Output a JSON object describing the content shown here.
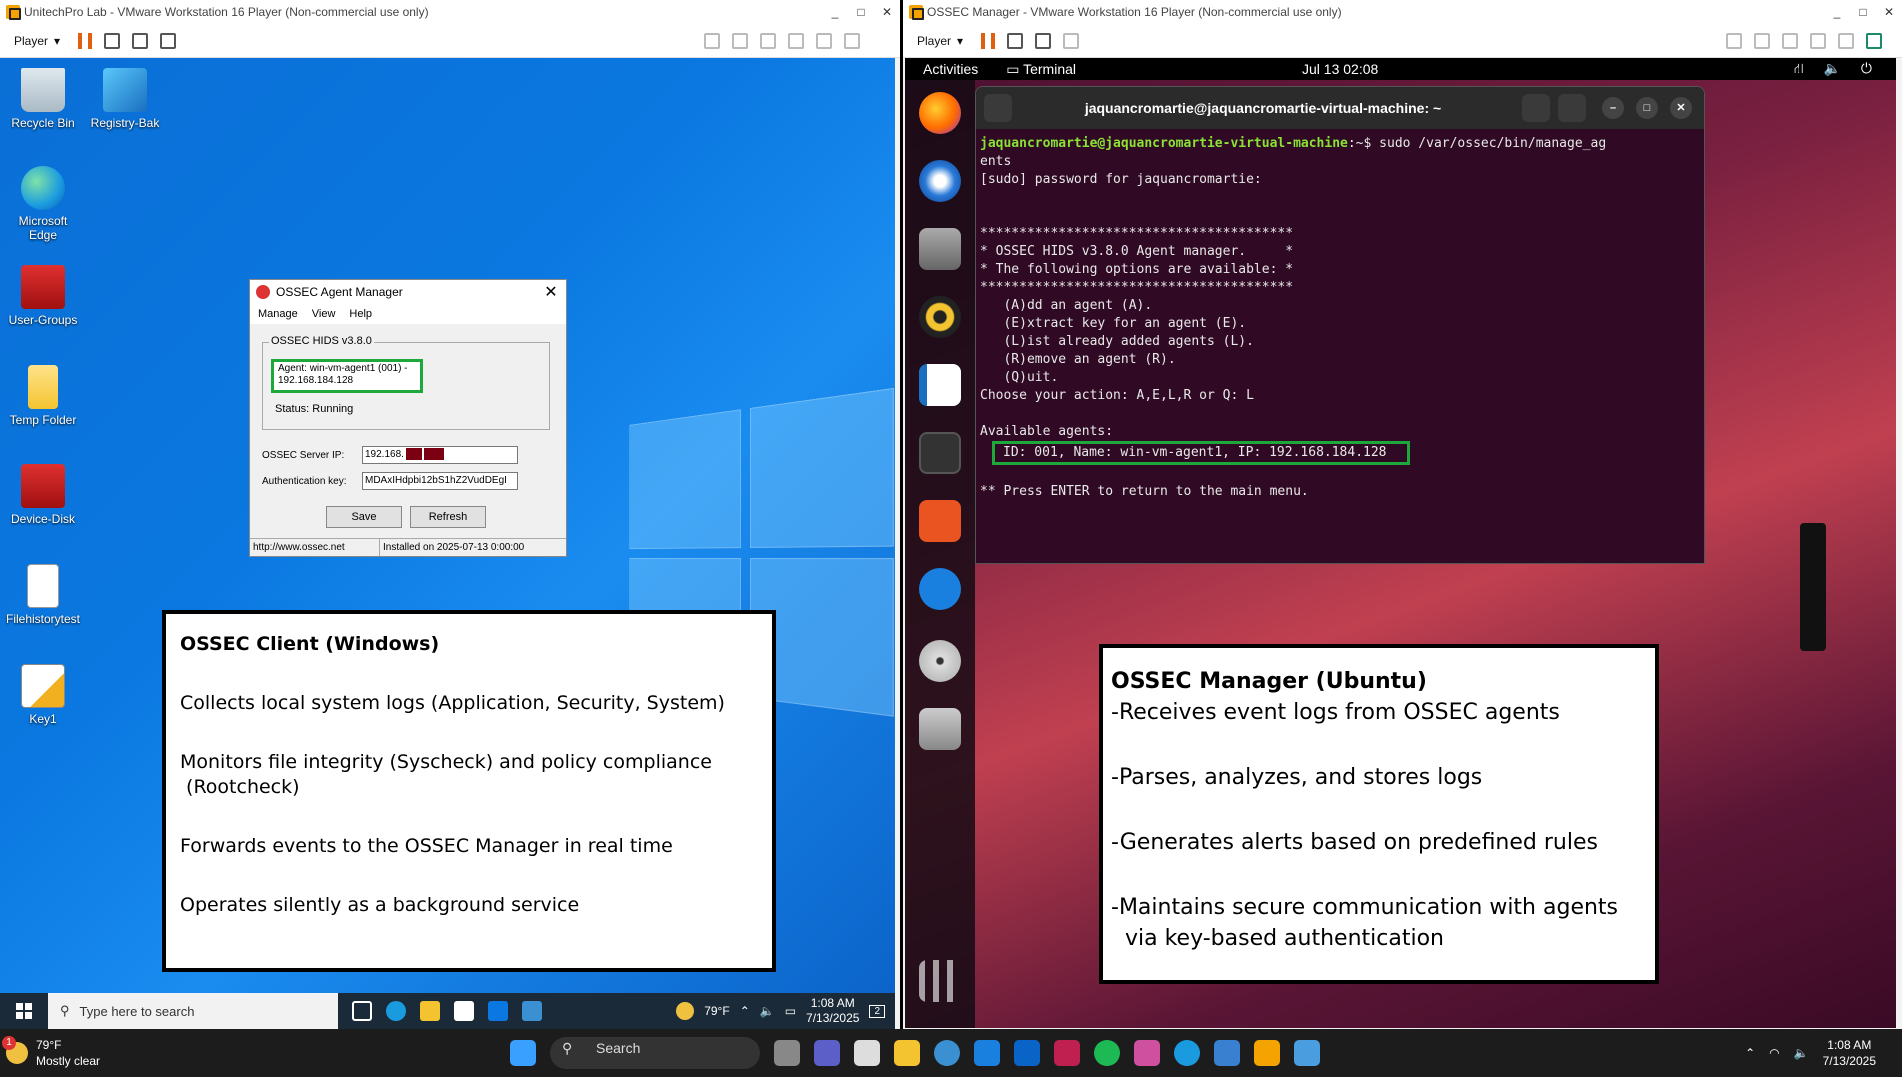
{
  "left_vm": {
    "title": "UnitechPro Lab - VMware Workstation 16 Player (Non-commercial use only)",
    "player_label": "Player",
    "controls": [
      "_",
      "□",
      "✕"
    ]
  },
  "right_vm": {
    "title": "OSSEC Manager - VMware Workstation 16 Player (Non-commercial use only)",
    "player_label": "Player",
    "controls": [
      "_",
      "□",
      "✕"
    ]
  },
  "windows_desktop": {
    "icons": [
      {
        "label": "Recycle Bin",
        "icon": "recycle-bin-icon"
      },
      {
        "label": "Registry-Bak",
        "icon": "registry-icon"
      },
      {
        "label": "Microsoft Edge",
        "icon": "edge-icon"
      },
      {
        "label": "User-Groups",
        "icon": "toolbox-icon"
      },
      {
        "label": "Temp Folder",
        "icon": "folder-icon"
      },
      {
        "label": "Device-Disk",
        "icon": "toolbox-icon"
      },
      {
        "label": "Filehistorytest",
        "icon": "document-icon"
      },
      {
        "label": "Key1",
        "icon": "certificate-icon"
      }
    ]
  },
  "ossec_dialog": {
    "title": "OSSEC Agent Manager",
    "menu": [
      "Manage",
      "View",
      "Help"
    ],
    "group_label": "OSSEC HIDS v3.8.0",
    "agent_line1": "Agent: win-vm-agent1 (001) -",
    "agent_line2": "192.168.184.128",
    "status": "Status: Running",
    "server_ip_label": "OSSEC Server IP:",
    "server_ip_value": "192.168.",
    "auth_key_label": "Authentication key:",
    "auth_key_value": "MDAxIHdpbi12bS1hZ2VudDEgI",
    "save_label": "Save",
    "refresh_label": "Refresh",
    "status_url": "http://www.ossec.net",
    "status_installed": "Installed on 2025-07-13 0:00:00"
  },
  "win_taskbar": {
    "search_placeholder": "Type here to search",
    "weather": "79°F",
    "time": "1:08 AM",
    "date": "7/13/2025",
    "notification_count": "2"
  },
  "client_note": {
    "title": "OSSEC Client (Windows)",
    "lines": [
      "Collects local system logs (Application, Security, System)",
      "Monitors file integrity (Syscheck) and policy compliance",
      " (Rootcheck)",
      "Forwards events to the OSSEC Manager in real time",
      "Operates silently as a background service"
    ]
  },
  "ubuntu": {
    "activities": "Activities",
    "app_label": "Terminal",
    "clock": "Jul 13  02:08",
    "terminal_title": "jaquancromartie@jaquancromartie-virtual-machine: ~",
    "prompt_user": "jaquancromartie@jaquancromartie-virtual-machine",
    "prompt_rest": ":~$ sudo /var/ossec/bin/manage_ag",
    "lines": [
      "ents",
      "[sudo] password for jaquancromartie:",
      "",
      "",
      "****************************************",
      "* OSSEC HIDS v3.8.0 Agent manager.     *",
      "* The following options are available: *",
      "****************************************",
      "   (A)dd an agent (A).",
      "   (E)xtract key for an agent (E).",
      "   (L)ist already added agents (L).",
      "   (R)emove an agent (R).",
      "   (Q)uit.",
      "Choose your action: A,E,L,R or Q: L",
      "",
      "Available agents:"
    ],
    "agent_line": "ID: 001, Name: win-vm-agent1, IP: 192.168.184.128",
    "footer_line": "** Press ENTER to return to the main menu."
  },
  "manager_note": {
    "title": "OSSEC Manager (Ubuntu)",
    "lines": [
      "-Receives event logs from OSSEC agents",
      "-Parses, analyzes, and stores logs",
      "-Generates alerts based on predefined rules",
      "-Maintains secure communication with agents",
      "  via key-based authentication"
    ]
  },
  "host_taskbar": {
    "weather_temp": "79°F",
    "weather_desc": "Mostly clear",
    "weather_badge": "1",
    "search_label": "Search",
    "time": "1:08 AM",
    "date": "7/13/2025"
  },
  "colors": {
    "highlight": "#1ca83a",
    "windows_blue": "#0a78e0",
    "terminal_bg": "#300a24"
  }
}
